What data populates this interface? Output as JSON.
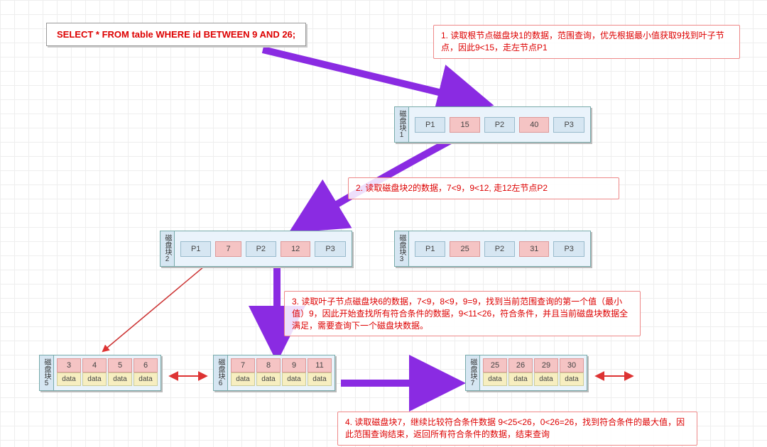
{
  "sql": "SELECT *  FROM table WHERE id BETWEEN 9 AND 26;",
  "notes": {
    "n1": "1. 读取根节点磁盘块1的数据，范围查询，优先根据最小值获取9找到叶子节点，因此9<15，走左节点P1",
    "n2": "2. 读取磁盘块2的数据，7<9，9<12, 走12左节点P2",
    "n3": "3. 读取叶子节点磁盘块6的数据，7<9，8<9，9=9，找到当前范围查询的第一个值（最小值）9，因此开始查找所有符合条件的数据，9<11<26，符合条件，并且当前磁盘块数据全满足，需要查询下一个磁盘块数据。",
    "n4": "4. 读取磁盘块7，继续比较符合条件数据 9<25<26，0<26=26，找到符合条件的最大值，因此范围查询结束，返回所有符合条件的数据，结束查询"
  },
  "labels": {
    "blk1": "磁盘块1",
    "blk2": "磁盘块2",
    "blk3": "磁盘块3",
    "blk5": "磁盘块5",
    "blk6": "磁盘块6",
    "blk7": "磁盘块7",
    "P1": "P1",
    "P2": "P2",
    "P3": "P3",
    "data": "data"
  },
  "internal": {
    "b1": {
      "k1": "15",
      "k2": "40"
    },
    "b2": {
      "k1": "7",
      "k2": "12"
    },
    "b3": {
      "k1": "25",
      "k2": "31"
    }
  },
  "leaves": {
    "b5": [
      "3",
      "4",
      "5",
      "6"
    ],
    "b6": [
      "7",
      "8",
      "9",
      "11"
    ],
    "b7": [
      "25",
      "26",
      "29",
      "30"
    ]
  }
}
